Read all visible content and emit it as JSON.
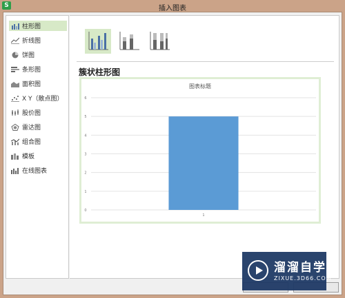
{
  "window": {
    "title": "插入图表",
    "app_icon": "S"
  },
  "sidebar": {
    "items": [
      {
        "label": "柱形图",
        "icon": "column-chart-icon",
        "active": true
      },
      {
        "label": "折线图",
        "icon": "line-chart-icon"
      },
      {
        "label": "饼图",
        "icon": "pie-chart-icon"
      },
      {
        "label": "条形图",
        "icon": "bar-chart-icon"
      },
      {
        "label": "面积图",
        "icon": "area-chart-icon"
      },
      {
        "label": "X Y（散点图）",
        "icon": "scatter-chart-icon"
      },
      {
        "label": "股价图",
        "icon": "stock-chart-icon"
      },
      {
        "label": "雷达图",
        "icon": "radar-chart-icon"
      },
      {
        "label": "组合图",
        "icon": "combo-chart-icon"
      },
      {
        "label": "模板",
        "icon": "template-icon"
      },
      {
        "label": "在线图表",
        "icon": "online-chart-icon"
      }
    ]
  },
  "subtypes": [
    "clustered-column-icon",
    "stacked-column-icon",
    "percent-stacked-column-icon"
  ],
  "main": {
    "heading": "簇状柱形图"
  },
  "colors": {
    "accent": "#5b9bd5",
    "active_bg": "#d7e9c7"
  },
  "chart_data": {
    "type": "bar",
    "title": "图表标题",
    "categories": [
      "1"
    ],
    "values": [
      5
    ],
    "ylim": [
      0,
      6
    ],
    "yticks": [
      "0",
      "1",
      "2",
      "3",
      "4",
      "5",
      "6"
    ],
    "grid": true,
    "color": "#5b9bd5"
  },
  "watermark": {
    "main": "溜溜自学",
    "sub": "ZIXUE.3D66.COM"
  }
}
